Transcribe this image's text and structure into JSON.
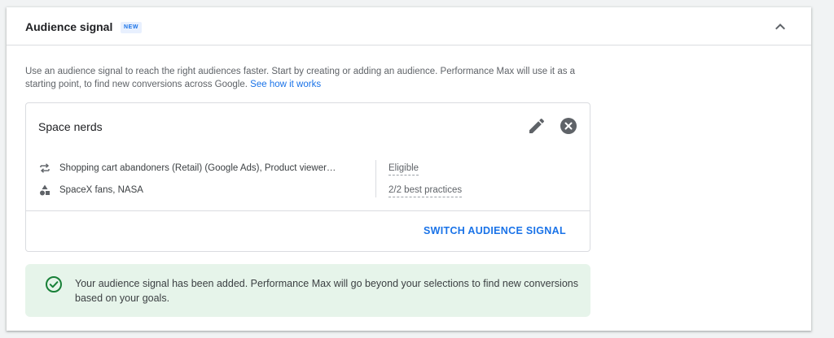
{
  "section": {
    "title": "Audience signal",
    "badge": "NEW",
    "description": "Use an audience signal to reach the right audiences faster. Start by creating or adding an audience. Performance Max will use it as a starting point, to find new conversions across Google.",
    "link_text": "See how it works"
  },
  "signal": {
    "name": "Space nerds",
    "rows": [
      {
        "icon": "repeat-icon",
        "text": "Shopping cart abandoners (Retail) (Google Ads), Product viewer…",
        "status": "Eligible"
      },
      {
        "icon": "shapes-icon",
        "text": "SpaceX fans, NASA",
        "status": "2/2 best practices"
      }
    ],
    "switch_label": "SWITCH AUDIENCE SIGNAL"
  },
  "banner": {
    "message": "Your audience signal has been added. Performance Max will go beyond your selections to find new conversions based on your goals."
  },
  "colors": {
    "accent": "#1a73e8",
    "success": "#188038",
    "success_bg": "#e6f4ea",
    "badge_bg": "#e8f0fe",
    "icon": "#5f6368"
  }
}
